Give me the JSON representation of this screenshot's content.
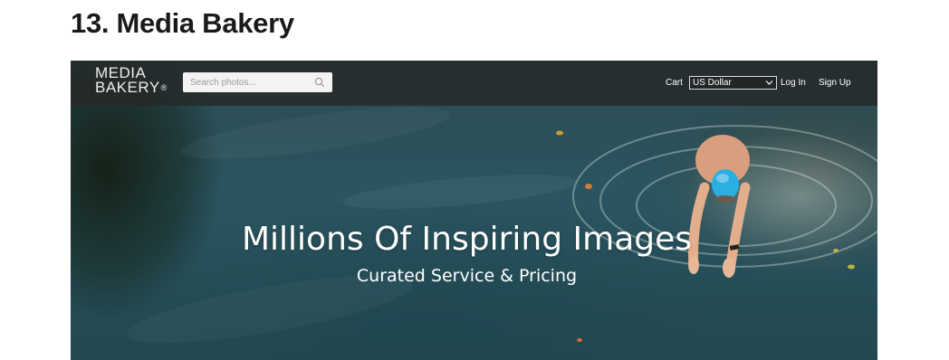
{
  "article": {
    "heading": "13. Media Bakery"
  },
  "site": {
    "logo": {
      "line1": "MEDIA",
      "line2": "BAKERY",
      "mark": "®"
    },
    "search": {
      "placeholder": "Search photos...",
      "icon": "search-icon"
    },
    "nav": {
      "cart_label": "Cart",
      "currency_selected": "US Dollar",
      "login_label": "Log In",
      "signup_label": "Sign Up"
    },
    "hero": {
      "headline": "Millions Of Inspiring Images",
      "subline": "Curated Service & Pricing"
    }
  },
  "colors": {
    "navbar_bg": "#262828",
    "water": "#2a5560",
    "text": "#ffffff",
    "swim_cap": "#2ab0e0"
  }
}
